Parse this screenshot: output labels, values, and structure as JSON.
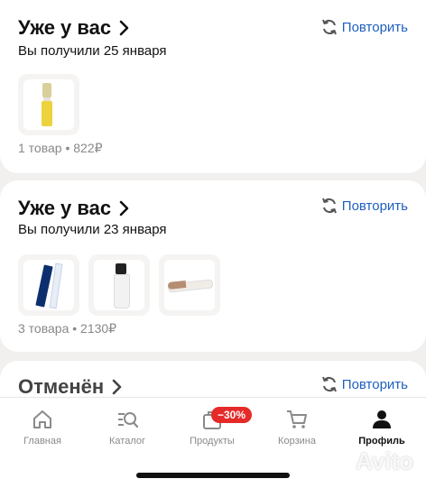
{
  "orders": [
    {
      "status": "Уже у вас",
      "date_line": "Вы получили 25 января",
      "repeat_label": "Повторить",
      "summary": "1 товар • 822₽",
      "products": [
        "yellow-pen-product"
      ]
    },
    {
      "status": "Уже у вас",
      "date_line": "Вы получили 23 января",
      "repeat_label": "Повторить",
      "summary": "3 товара • 2130₽",
      "products": [
        "blue-box-pen-product",
        "white-tube-product",
        "stick-applicator-product"
      ]
    },
    {
      "status": "Отменён",
      "repeat_label": "Повторить"
    }
  ],
  "tabbar": {
    "items": [
      {
        "label": "Главная",
        "icon": "home-icon"
      },
      {
        "label": "Каталог",
        "icon": "catalog-search-icon"
      },
      {
        "label": "Продукты",
        "icon": "grocery-bag-icon",
        "badge": "−30%"
      },
      {
        "label": "Корзина",
        "icon": "cart-icon"
      },
      {
        "label": "Профиль",
        "icon": "profile-icon",
        "active": true
      }
    ]
  },
  "colors": {
    "accent_blue": "#1f5fbf",
    "badge_red": "#e52a2a",
    "product_yellow": "#ecd23e"
  },
  "watermark": "Avito"
}
